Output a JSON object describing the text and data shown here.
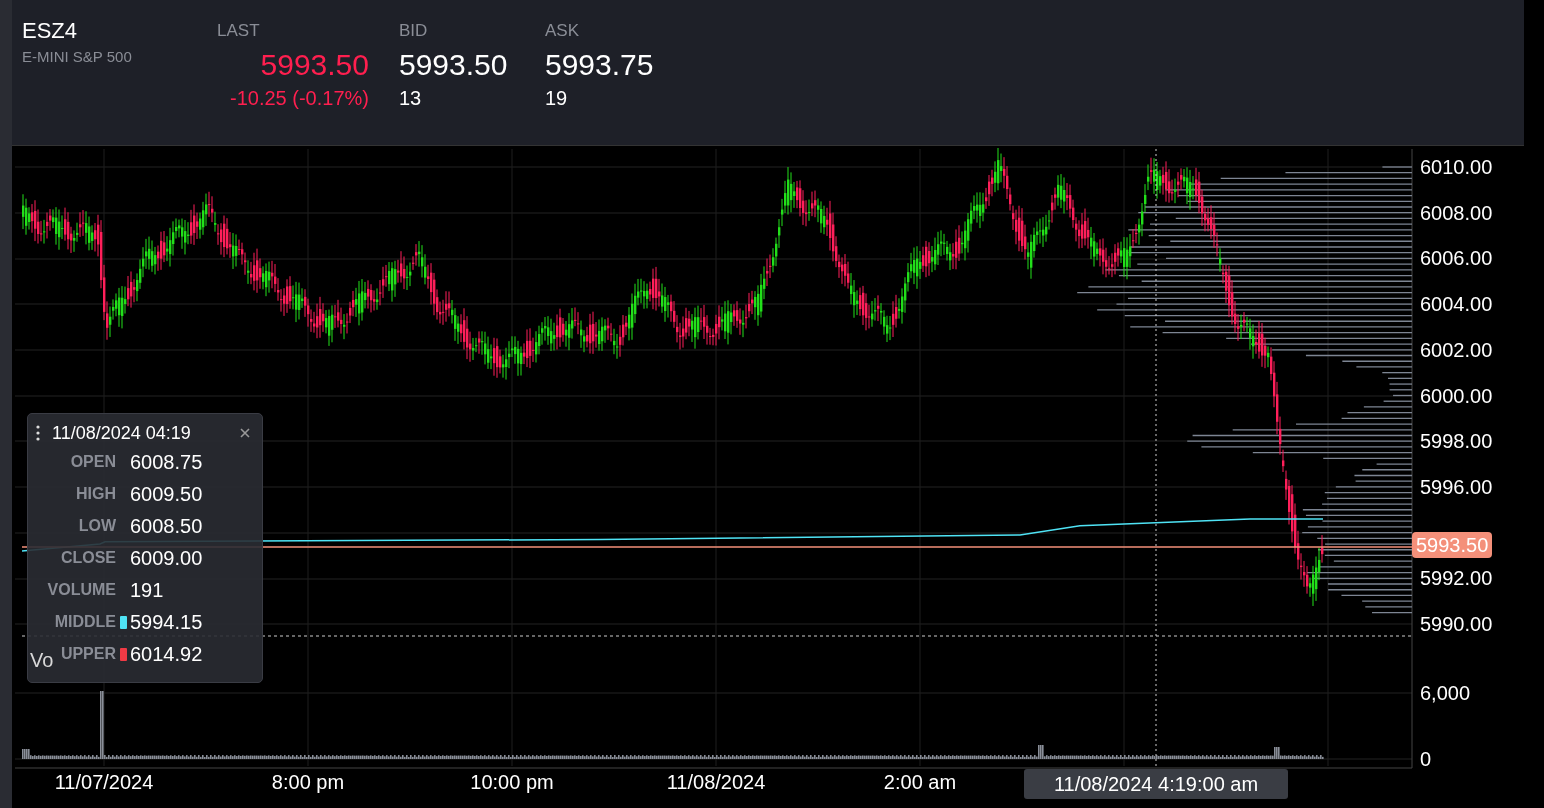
{
  "instrument": {
    "symbol": "ESZ4",
    "name": "E-MINI S&P 500"
  },
  "quotes": [
    {
      "label": "LAST",
      "price": "5993.50",
      "detail": "-10.25 (-0.17%)",
      "color": "#ff1f4f"
    },
    {
      "label": "BID",
      "price": "5993.50",
      "detail": "13",
      "color": "#ffffff"
    },
    {
      "label": "ASK",
      "price": "5993.75",
      "detail": "19",
      "color": "#ffffff"
    }
  ],
  "chart": {
    "price_axis": [
      "6010.00",
      "6008.00",
      "6006.00",
      "6004.00",
      "6002.00",
      "6000.00",
      "5998.00",
      "5996.00",
      "5992.00",
      "5990.00"
    ],
    "last_price_badge": "5993.50",
    "volume_axis": [
      "6,000",
      "0"
    ],
    "volume_pane_label": "Vo",
    "time_axis": [
      "11/07/2024",
      "8:00 pm",
      "10:00 pm",
      "11/08/2024",
      "2:00 am"
    ],
    "crosshair_time": "11/08/2024 4:19:00 am",
    "tooltip": {
      "title": "11/08/2024 04:19",
      "rows": [
        {
          "label": "OPEN",
          "value": "6008.75"
        },
        {
          "label": "HIGH",
          "value": "6009.50"
        },
        {
          "label": "LOW",
          "value": "6008.50"
        },
        {
          "label": "CLOSE",
          "value": "6009.00"
        },
        {
          "label": "VOLUME",
          "value": "191"
        },
        {
          "label": "MIDDLE",
          "value": "5994.15",
          "color": "#4fe3f5"
        },
        {
          "label": "UPPER",
          "value": "6014.92",
          "color": "#f03a45"
        }
      ]
    }
  }
}
